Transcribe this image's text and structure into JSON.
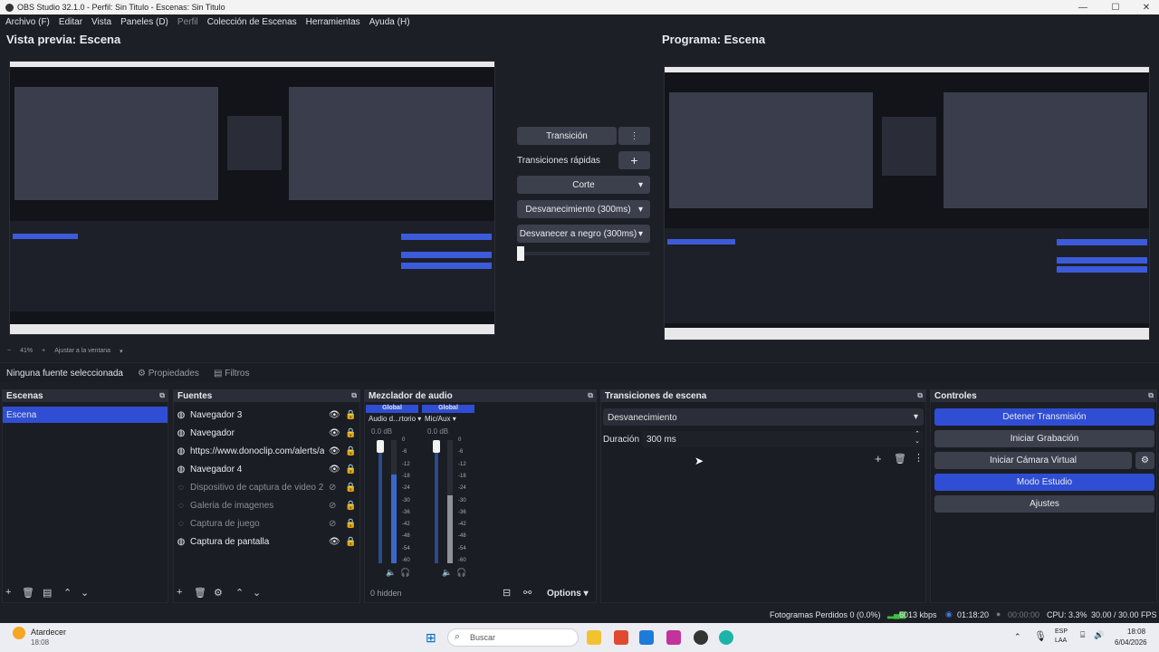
{
  "window": {
    "title": "OBS Studio 32.1.0 - Perfil: Sin Titulo - Escenas: Sin Titulo"
  },
  "menu": {
    "items": [
      "Archivo (F)",
      "Editar",
      "Vista",
      "Paneles (D)",
      "Perfil",
      "Colección de Escenas",
      "Herramientas",
      "Ayuda (H)"
    ]
  },
  "preview": {
    "title": "Vista previa: Escena",
    "zoom": "41%",
    "fit": "Ajustar a la ventana"
  },
  "program": {
    "title": "Programa: Escena"
  },
  "transition_panel": {
    "transition_label": "Transición",
    "quick_label": "Transiciones rápidas",
    "quick": [
      "Corte",
      "Desvanecimiento (300ms)",
      "Desvanecer a negro (300ms)"
    ]
  },
  "source_bar": {
    "none": "Ninguna fuente seleccionada",
    "properties": "Propiedades",
    "filters": "Filtros"
  },
  "scenes": {
    "title": "Escenas",
    "items": [
      "Escena"
    ]
  },
  "sources": {
    "title": "Fuentes",
    "items": [
      {
        "name": "Navegador 3",
        "visible": true
      },
      {
        "name": "Navegador",
        "visible": true
      },
      {
        "name": "https://www.donoclip.com/alerts/abe",
        "visible": true
      },
      {
        "name": "Navegador 4",
        "visible": true
      },
      {
        "name": "Dispositivo de captura de video 2",
        "visible": false
      },
      {
        "name": "Galeria de imagenes",
        "visible": false
      },
      {
        "name": "Captura de juego",
        "visible": false
      },
      {
        "name": "Captura de pantalla",
        "visible": true
      }
    ]
  },
  "mixer": {
    "title": "Mezclador de audio",
    "channels": [
      {
        "tag": "Global",
        "name": "Audio d...rtorio",
        "db": "0.0 dB",
        "level": 0.72
      },
      {
        "tag": "Global",
        "name": "Mic/Aux",
        "db": "0.0 dB",
        "level": 0.55
      }
    ],
    "scale": [
      "0",
      "-6",
      "-12",
      "-18",
      "-24",
      "-30",
      "-36",
      "-42",
      "-48",
      "-54",
      "-60"
    ],
    "hidden": "0 hidden",
    "options": "Options"
  },
  "scene_transitions": {
    "title": "Transiciones de escena",
    "selected": "Desvanecimiento",
    "duration_label": "Duración",
    "duration": "300 ms"
  },
  "controls": {
    "title": "Controles",
    "buttons": [
      "Detener Transmisión",
      "Iniciar Grabación",
      "Iniciar Cámara Virtual",
      "Modo Estudio",
      "Ajustes"
    ]
  },
  "status": {
    "dropped": "Fotogramas Perdidos 0 (0.0%)",
    "bitrate": "6013 kbps",
    "stream_time": "01:18:20",
    "rec_time": "00:00:00",
    "cpu": "CPU: 3.3%",
    "fps": "30.00 / 30.00 FPS"
  },
  "taskbar": {
    "weather": "Atardecer",
    "weather_time": "18:08",
    "search": "Buscar",
    "lang1": "ESP",
    "lang2": "LAA",
    "time": "18:08",
    "date": "6/04/2026"
  },
  "colors": {
    "accent": "#2f4ed4",
    "bg": "#1d1f26",
    "panel": "#2b2e38"
  }
}
